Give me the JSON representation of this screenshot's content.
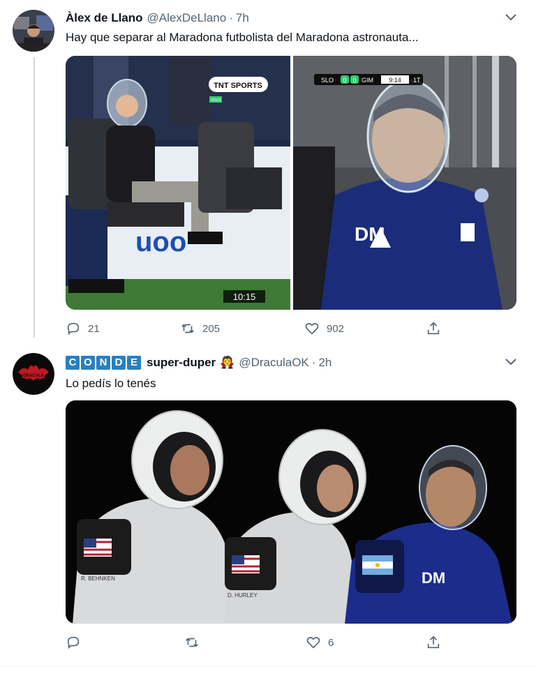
{
  "tweet1": {
    "name": "Àlex de Llano",
    "handle": "@AlexDeLlano",
    "dot": "·",
    "time": "7h",
    "text": "Hay que separar al Maradona futbolista del Maradona astronauta...",
    "left_image": {
      "network_logo": "TNT SPORTS",
      "live_label": "VIVO",
      "clock": "10:15"
    },
    "right_image": {
      "score_home": "SLO",
      "score_home_goals": "0",
      "score_away_goals": "0",
      "score_away": "GIM",
      "match_time": "9:14",
      "half": "1T",
      "shirt_text": "DM"
    },
    "actions": {
      "replies": "21",
      "retweets": "205",
      "likes": "902"
    }
  },
  "tweet2": {
    "name_letters": [
      "C",
      "O",
      "N",
      "D",
      "E"
    ],
    "name": "super-duper",
    "name_emoji": "🧛",
    "handle": "@DraculaOK",
    "dot": "·",
    "time": "2h",
    "text": "Lo pedís lo tenés",
    "image": {
      "astronaut1_tag": "R. BEHNKEN",
      "astronaut2_tag": "D. HURLEY",
      "astronaut3_shirt": "DM"
    },
    "actions": {
      "replies": "",
      "retweets": "",
      "likes": "6"
    }
  },
  "icons": {
    "reply": "reply-icon",
    "retweet": "retweet-icon",
    "like": "heart-icon",
    "share": "share-icon",
    "caret": "chevron-down-icon"
  },
  "colors": {
    "text_primary": "#0f1419",
    "text_secondary": "#536471",
    "thread_line": "#cfd9de",
    "conde_blue": "#2a7fbf"
  }
}
